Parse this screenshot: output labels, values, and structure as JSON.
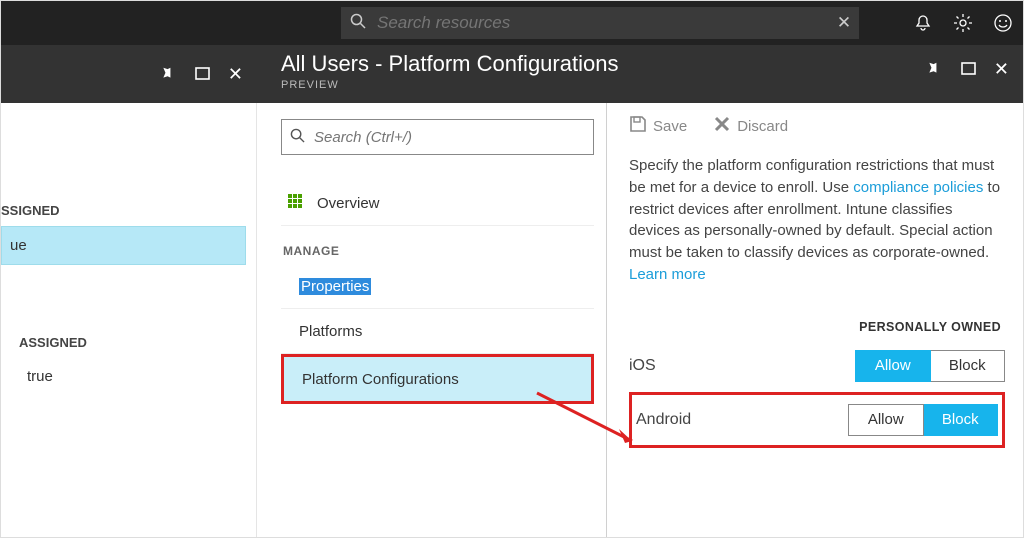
{
  "topbar": {
    "search_placeholder": "Search resources"
  },
  "blade": {
    "title": "All Users - Platform Configurations",
    "subtitle": "PREVIEW"
  },
  "left": {
    "section1_label": "SSIGNED",
    "section1_value": "ue",
    "section2_label": "ASSIGNED",
    "section2_value": "true"
  },
  "mid": {
    "search_placeholder": "Search (Ctrl+/)",
    "overview": "Overview",
    "manage_label": "MANAGE",
    "items": {
      "properties": "Properties",
      "platforms": "Platforms",
      "platform_configs": "Platform Configurations"
    }
  },
  "right": {
    "save": "Save",
    "discard": "Discard",
    "desc_pre": "Specify the platform configuration restrictions that must be met for a device to enroll. Use ",
    "link1": "compliance policies",
    "desc_mid": " to restrict devices after enrollment. Intune classifies devices as personally-owned by default. Special action must be taken to classify devices as corporate-owned. ",
    "link2": "Learn more",
    "col_header": "PERSONALLY OWNED",
    "rows": {
      "ios": {
        "label": "iOS",
        "allow": "Allow",
        "block": "Block",
        "value": "Allow"
      },
      "android": {
        "label": "Android",
        "allow": "Allow",
        "block": "Block",
        "value": "Block"
      }
    }
  }
}
